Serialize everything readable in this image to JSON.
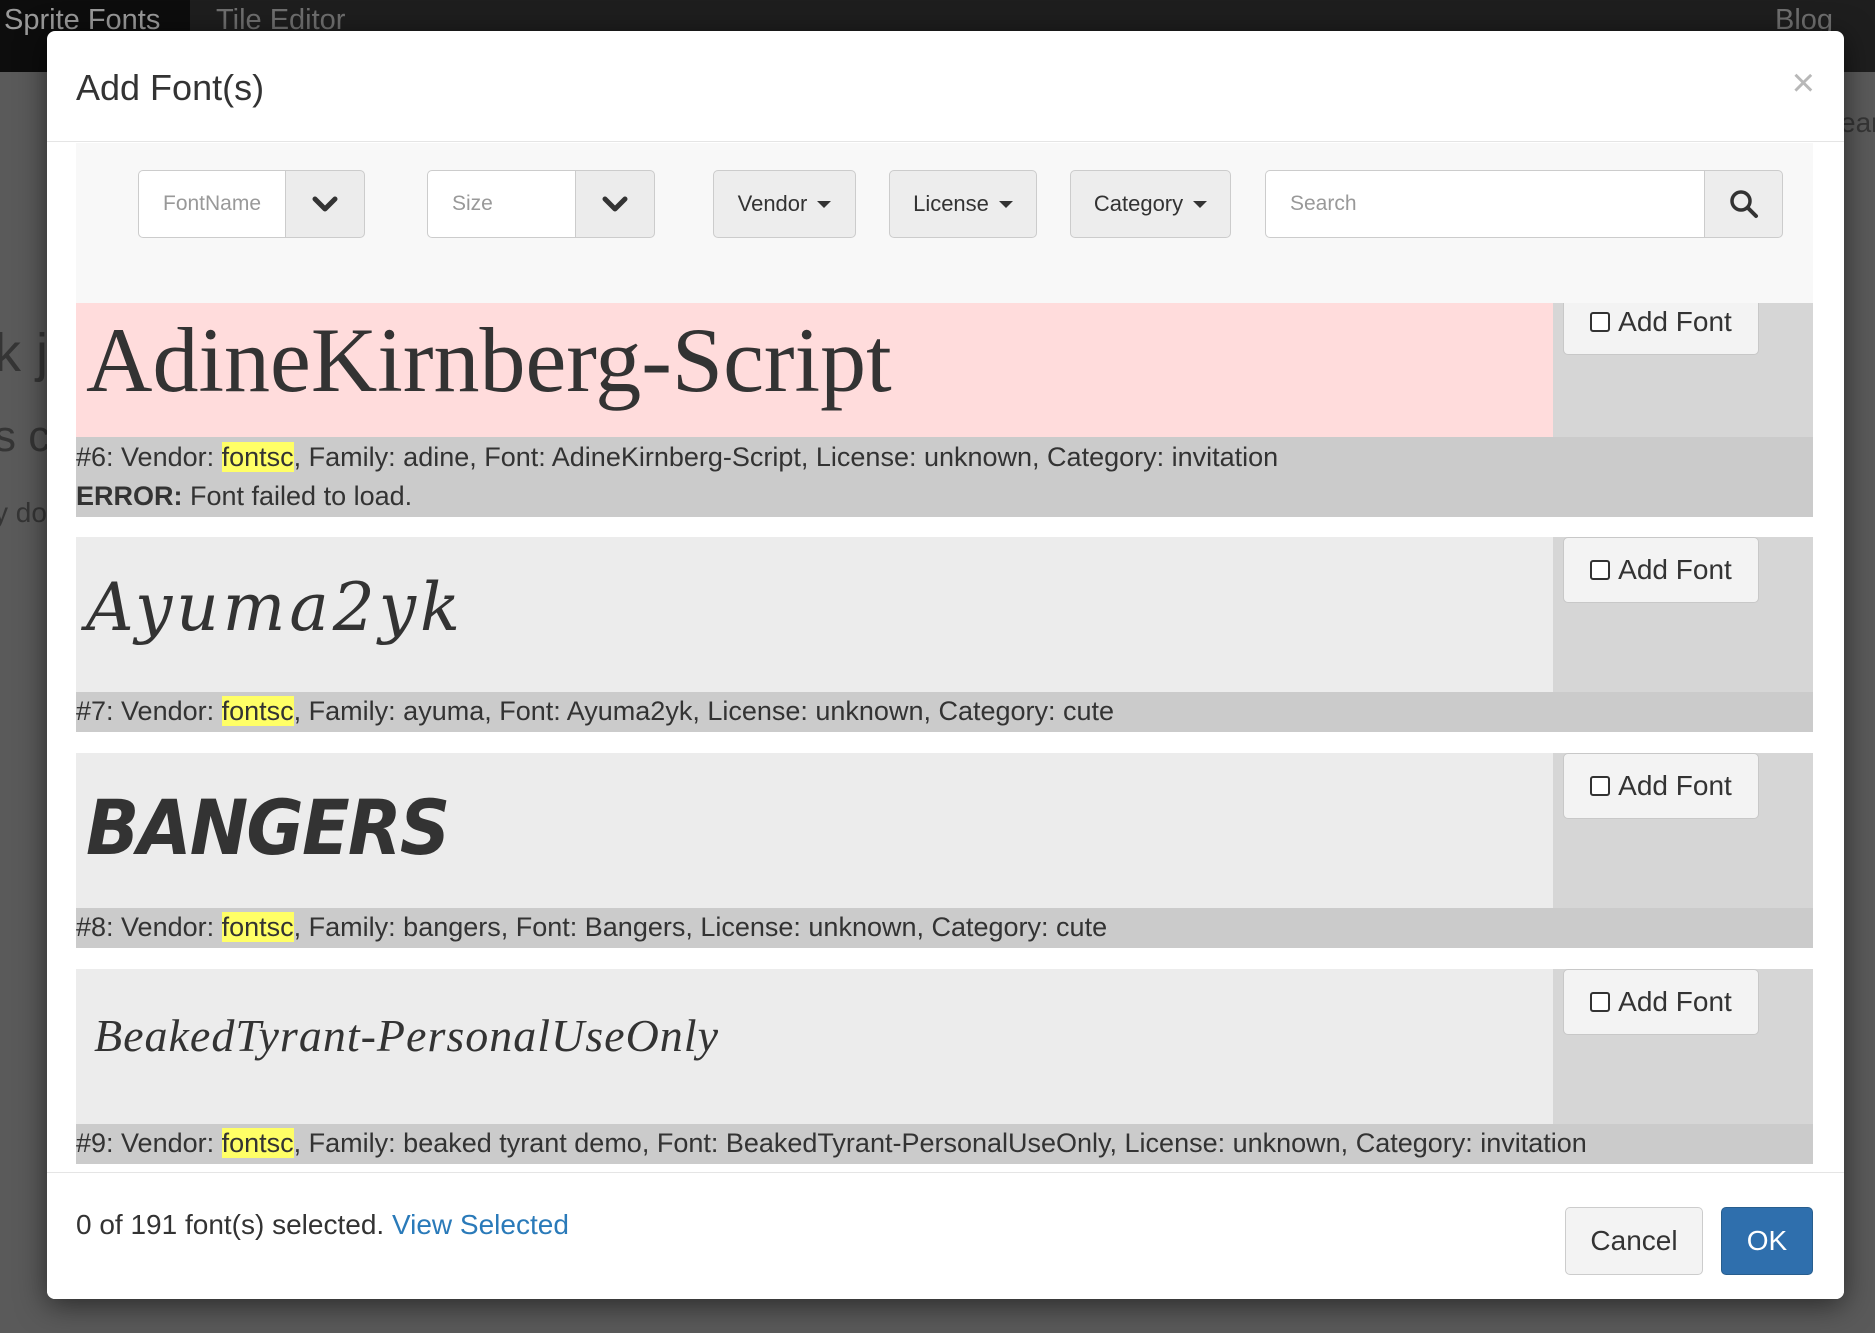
{
  "nav": {
    "brand": "Sprite Fonts",
    "tile_editor": "Tile Editor",
    "blog": "Blog"
  },
  "background": {
    "frag1": "k j",
    "frag2": "s c",
    "frag3": "y do",
    "frag4": "ear"
  },
  "modal": {
    "title": "Add Font(s)",
    "close_glyph": "×"
  },
  "toolbar": {
    "fontname_placeholder": "FontName",
    "size_placeholder": "Size",
    "vendor_label": "Vendor",
    "license_label": "License",
    "category_label": "Category",
    "search_placeholder": "Search",
    "icons": [
      "chevron-down-icon",
      "chevron-down-icon",
      "search-icon"
    ]
  },
  "add_font_label": "Add Font",
  "highlight_color": "#ffff66",
  "error_bg_color": "#ffdcdc",
  "fonts": [
    {
      "preview": "AdineKirnberg-Script",
      "prefix": "#6: Vendor: ",
      "vendor": "fontsc",
      "rest": ", Family: adine, Font: AdineKirnberg-Script, License: unknown, Category: invitation",
      "error_label": "ERROR:",
      "error_text": " Font failed to load."
    },
    {
      "preview": "Ayuma2yk",
      "prefix": "#7: Vendor: ",
      "vendor": "fontsc",
      "rest": ", Family: ayuma, Font: Ayuma2yk, License: unknown, Category: cute"
    },
    {
      "preview": "BANGERS",
      "prefix": "#8: Vendor: ",
      "vendor": "fontsc",
      "rest": ", Family: bangers, Font: Bangers, License: unknown, Category: cute"
    },
    {
      "preview": "BeakedTyrant-PersonalUseOnly",
      "prefix": "#9: Vendor: ",
      "vendor": "fontsc",
      "rest": ", Family: beaked tyrant demo, Font: BeakedTyrant-PersonalUseOnly, License: unknown, Category: invitation"
    }
  ],
  "footer": {
    "selected_text": "0 of 191 font(s) selected.",
    "view_selected": "View Selected",
    "cancel": "Cancel",
    "ok": "OK"
  }
}
